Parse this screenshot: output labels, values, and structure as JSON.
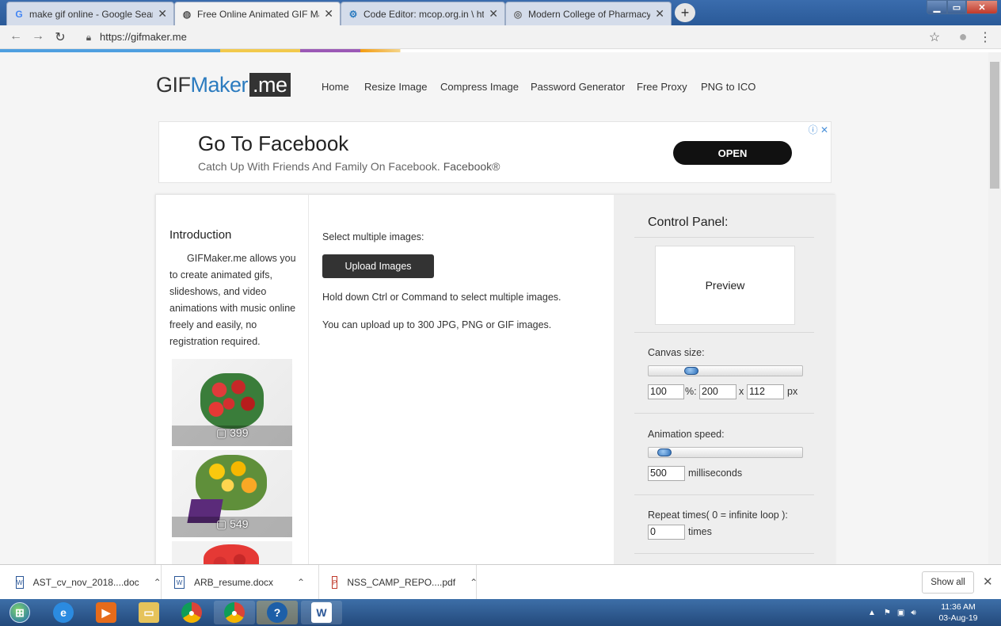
{
  "browser": {
    "tabs": [
      {
        "label": "make gif online - Google Search",
        "icon": "google-icon",
        "active": false
      },
      {
        "label": "Free Online Animated GIF Maker",
        "icon": "globe-icon",
        "active": true
      },
      {
        "label": "Code Editor: mcop.org.in \\ httpdocs",
        "icon": "code-icon",
        "active": false
      },
      {
        "label": "Modern College of Pharmacy Yamuna",
        "icon": "college-icon",
        "active": false
      }
    ],
    "new_tab_label": "+",
    "url": "https://gifmaker.me"
  },
  "site": {
    "logo_gif": "GIF",
    "logo_maker": "Maker",
    "logo_me": ".me",
    "nav": [
      "Home",
      "Resize Image",
      "Compress Image",
      "Password Generator",
      "Free Proxy",
      "PNG to ICO"
    ]
  },
  "ad": {
    "title": "Go To Facebook",
    "subtitle": "Catch Up With Friends And Family On Facebook.",
    "brand": "Facebook®",
    "cta": "OPEN"
  },
  "intro": {
    "heading": "Introduction",
    "text": "GIFMaker.me allows you to create animated gifs, slideshows, and video animations with music online freely and easily, no registration required.",
    "ad_counts": [
      "399",
      "549"
    ]
  },
  "upload": {
    "select_label": "Select multiple images:",
    "button": "Upload Images",
    "hint1": "Hold down Ctrl or Command to select multiple images.",
    "hint2": "You can upload up to 300 JPG, PNG or GIF images."
  },
  "control_panel": {
    "heading": "Control Panel:",
    "preview": "Preview",
    "canvas_label": "Canvas size:",
    "canvas_percent": "100",
    "percent_sep": "%:",
    "canvas_width": "200",
    "x_sep": "x",
    "canvas_height": "112",
    "px_label": "px",
    "speed_label": "Animation speed:",
    "speed_value": "500",
    "speed_unit": "milliseconds",
    "repeat_label": "Repeat times( 0 = infinite loop ):",
    "repeat_value": "0",
    "repeat_unit": "times"
  },
  "downloads": {
    "items": [
      {
        "name": "AST_cv_nov_2018....doc",
        "type": "doc"
      },
      {
        "name": "ARB_resume.docx",
        "type": "doc"
      },
      {
        "name": "NSS_CAMP_REPO....pdf",
        "type": "pdf"
      }
    ],
    "show_all": "Show all"
  },
  "taskbar": {
    "time": "11:36 AM",
    "date": "03-Aug-19"
  }
}
